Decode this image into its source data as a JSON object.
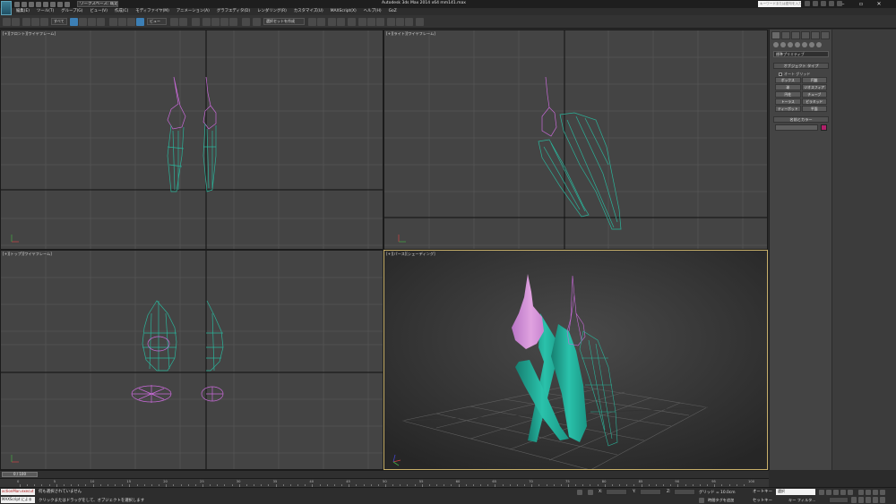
{
  "app": {
    "window_title": "Autodesk 3ds Max  2014 x64      mm141.max",
    "workspace": "ワークスペース: 既定値",
    "help_search_placeholder": "キーワードまたは語句を入力"
  },
  "menu": [
    "編集(E)",
    "ツール(T)",
    "グループ(G)",
    "ビュー(V)",
    "作成(C)",
    "モディファイヤ(M)",
    "アニメーション(A)",
    "グラフエディタ(D)",
    "レンダリング(R)",
    "カスタマイズ(U)",
    "MAXScript(X)",
    "ヘルプ(H)",
    "GoZ"
  ],
  "toolbar": {
    "filter_select": "すべて",
    "coord_select": "ビュー",
    "named_selection": "選択セットを作成"
  },
  "viewports": {
    "front": "[+][フロント][ワイヤフレーム]",
    "right": "[+][ライト][ワイヤフレーム]",
    "top": "[+][トップ][ワイヤフレーム]",
    "persp": "[+][パース][シェーディング]"
  },
  "command_panel": {
    "category": "標準プリミティブ",
    "object_type_title": "オブジェクト タイプ",
    "autogrid_label": "オート グリッド",
    "primitives": [
      "ボックス",
      "円錐",
      "球",
      "ジオスフィア",
      "円柱",
      "チューブ",
      "トーラス",
      "ピラミッド",
      "ティーポット",
      "平面"
    ],
    "name_color_title": "名前とカラー",
    "name_value": "",
    "object_color": "#b0206a"
  },
  "timeline": {
    "thumb": "0 / 100",
    "ticks": [
      "0",
      "5",
      "10",
      "15",
      "20",
      "25",
      "30",
      "35",
      "40",
      "45",
      "50",
      "55",
      "60",
      "65",
      "70",
      "75",
      "80",
      "85",
      "90",
      "95",
      "100"
    ]
  },
  "status": {
    "maxscript_a": "actionMan.execut",
    "maxscript_b": "MAXScript による",
    "selection_message": "何も選択されていません",
    "prompt_message": "クリックまたはドラッグをして、オブジェクトを選択します",
    "x_label": "X:",
    "y_label": "Y:",
    "z_label": "Z:",
    "grid_readout": "グリッド = 10.0cm",
    "add_time_tag": "時間タグを追加",
    "auto_key": "オートキー",
    "set_key": "セットキー",
    "selection_dropdown": "選択",
    "key_filter": "キー フィルタ..."
  },
  "colors": {
    "active_border": "#c8b06a",
    "wire_pink": "#c86ad8",
    "wire_teal": "#2bb39a",
    "solid_pink": "#d890d8",
    "solid_teal": "#23b09c"
  }
}
